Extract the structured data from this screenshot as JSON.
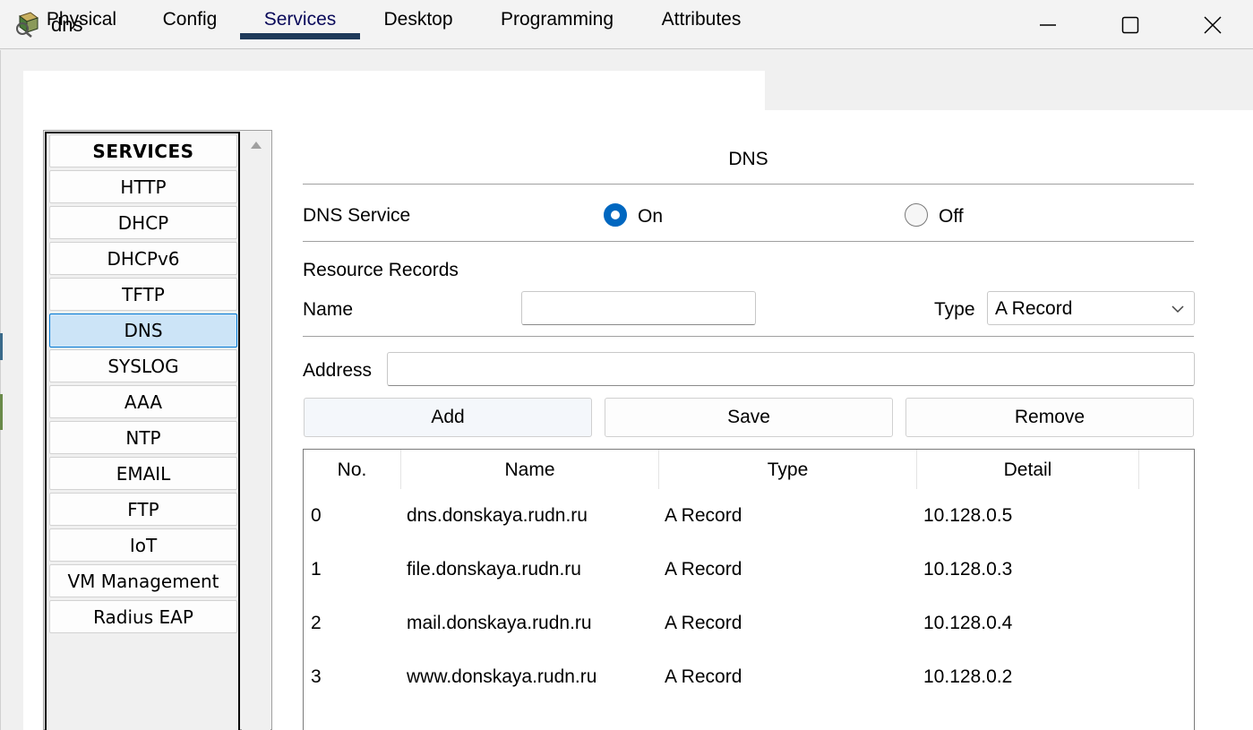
{
  "window": {
    "title": "dns",
    "app_icon": "packet-tracer-server-icon"
  },
  "tabs": [
    {
      "label": "Physical"
    },
    {
      "label": "Config"
    },
    {
      "label": "Services",
      "active": true
    },
    {
      "label": "Desktop"
    },
    {
      "label": "Programming"
    },
    {
      "label": "Attributes"
    }
  ],
  "services": {
    "header": "SERVICES",
    "items": [
      "HTTP",
      "DHCP",
      "DHCPv6",
      "TFTP",
      "DNS",
      "SYSLOG",
      "AAA",
      "NTP",
      "EMAIL",
      "FTP",
      "IoT",
      "VM Management",
      "Radius EAP"
    ],
    "selected": "DNS"
  },
  "dns": {
    "title": "DNS",
    "service_label": "DNS Service",
    "on_label": "On",
    "off_label": "Off",
    "service_state": "On",
    "resource_records_label": "Resource Records",
    "name_label": "Name",
    "name_value": "",
    "type_label": "Type",
    "type_value": "A Record",
    "address_label": "Address",
    "address_value": "",
    "buttons": {
      "add": "Add",
      "save": "Save",
      "remove": "Remove"
    }
  },
  "records": {
    "columns": [
      "No.",
      "Name",
      "Type",
      "Detail"
    ],
    "rows": [
      {
        "no": "0",
        "name": "dns.donskaya.rudn.ru",
        "type": "A Record",
        "detail": "10.128.0.5"
      },
      {
        "no": "1",
        "name": "file.donskaya.rudn.ru",
        "type": "A Record",
        "detail": "10.128.0.3"
      },
      {
        "no": "2",
        "name": "mail.donskaya.rudn.ru",
        "type": "A Record",
        "detail": "10.128.0.4"
      },
      {
        "no": "3",
        "name": "www.donskaya.rudn.ru",
        "type": "A Record",
        "detail": "10.128.0.2"
      }
    ]
  },
  "colors": {
    "accent": "#0067c0",
    "tab_underline": "#1f3a5a",
    "selected_item_bg": "#cce4f7",
    "selected_item_border": "#0078d4"
  }
}
